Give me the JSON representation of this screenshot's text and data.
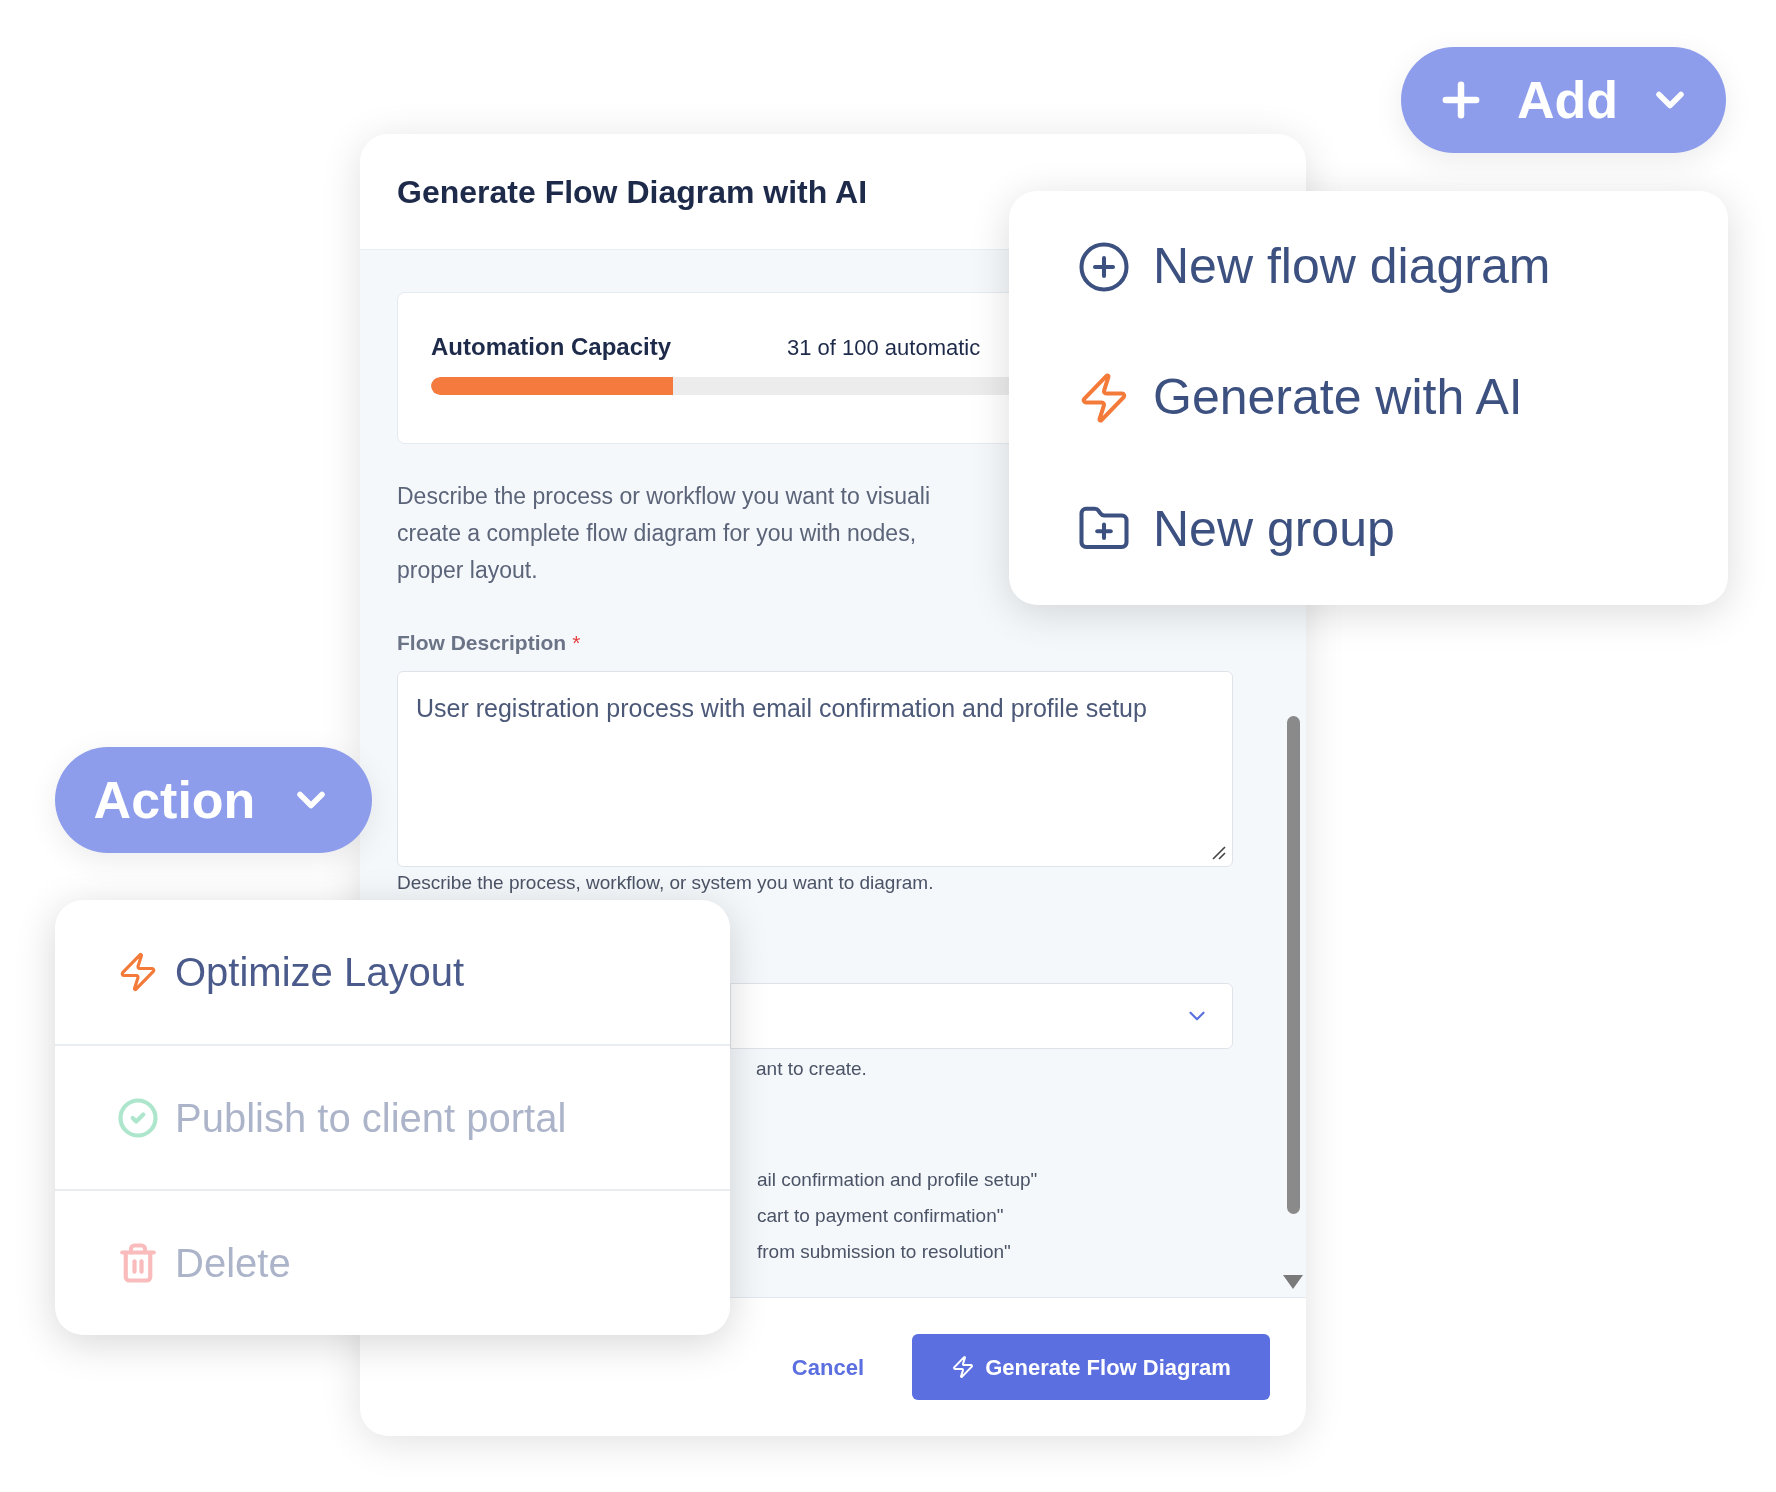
{
  "dialog": {
    "title": "Generate Flow Diagram with AI",
    "capacity": {
      "label": "Automation Capacity",
      "count": "31 of 100 automatic",
      "level": 0.31
    },
    "description_lines": [
      "Describe the process or workflow you want to visuali",
      "create a complete flow diagram for you with nodes,",
      "proper layout."
    ],
    "flow_description": {
      "label": "Flow Description",
      "required_mark": "*",
      "value": "User registration process with email confirmation and profile setup",
      "help": "Describe the process, workflow, or system you want to diagram."
    },
    "select_help": "ant to create.",
    "example_lines": [
      "ail confirmation and profile setup\"",
      "cart to payment confirmation\"",
      "from submission to resolution\""
    ],
    "buttons": [
      {
        "kind": "link",
        "label": "Cancel"
      },
      {
        "kind": "primary",
        "label": "Generate Flow Diagram"
      }
    ]
  },
  "add_button": {
    "label": "Add"
  },
  "add_menu": [
    {
      "kind": "new",
      "label": "New flow diagram"
    },
    {
      "kind": "ai",
      "label": "Generate with AI"
    },
    {
      "kind": "group",
      "label": "New group"
    }
  ],
  "action_button": {
    "label": "Action"
  },
  "action_menu": [
    {
      "kind": "ai",
      "label": "Optimize Layout",
      "dimmed": false
    },
    {
      "kind": "publish",
      "label": "Publish to client portal",
      "dimmed": true
    },
    {
      "kind": "delete",
      "label": "Delete",
      "dimmed": true
    }
  ]
}
